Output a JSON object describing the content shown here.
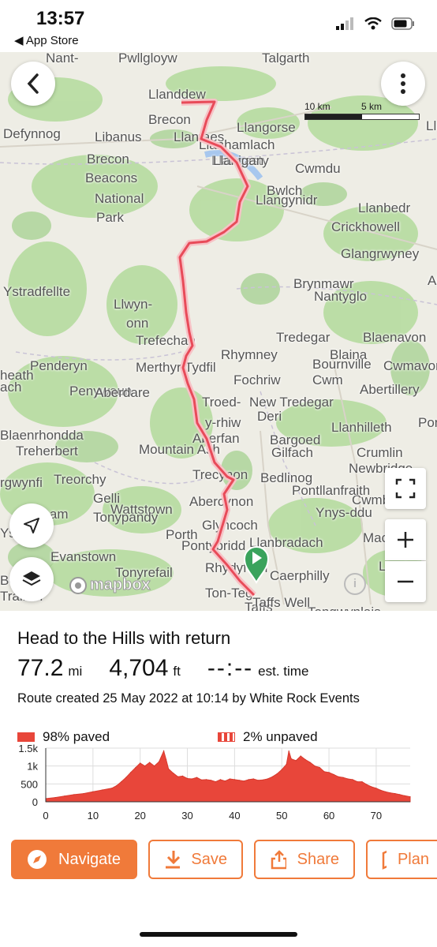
{
  "status": {
    "time": "13:57",
    "back_app": "App Store"
  },
  "map": {
    "scale": {
      "left": "10 km",
      "mid": "5 km"
    },
    "attribution": "mapbox",
    "places": [
      "Nant-",
      "Pwllgloyw",
      "Talgarth",
      "Llanddew",
      "Brecon",
      "Llangorse",
      "Defynnog",
      "Libanus",
      "Llanfaes",
      "Llanhamlach",
      "Llangasty",
      "Llanigan",
      "Brecon",
      "Beacons",
      "National",
      "Park",
      "Cwmdu",
      "Bwlch",
      "Llangynidr",
      "Llanbedr",
      "Crickhowell",
      "Glangrwyney",
      "Ystradfellte",
      "Llwyn-",
      "onn",
      "Brynmawr",
      "Nantyglo",
      "Trefechan",
      "Tredegar",
      "Blaina",
      "Blaenavon",
      "Penderyn",
      "Rhymney",
      "Bournville",
      "Cwmavon",
      "Merthyr Tydfil",
      "Cwm",
      "Abertillery",
      "Penywaun",
      "Fochriw",
      "Aberdare",
      "Troed-",
      "New Tredegar",
      "y-rhiw",
      "Deri",
      "Llanhilleth",
      "Blaenrhondda",
      "Aberfan",
      "Bargoed",
      "Treherbert",
      "Mountain Ash",
      "Gilfach",
      "Crumlin",
      "Treorchy",
      "Trecynon",
      "Newbridge",
      "Cwmbran",
      "Gelli",
      "Wattstown",
      "Abercynon",
      "Pontllanfraith",
      "Tonypandy",
      "Glyncoch",
      "Ynys-ddu",
      "Porth",
      "Llanbradach",
      "Evanstown",
      "Pontypridd",
      "Tonyrefail",
      "Rhydyfelin",
      "Caerphilly",
      "Ton-Teg",
      "Machen",
      "Tongwynlais",
      "Ystrad",
      "Llantwit",
      "Bedlinog",
      "heath",
      "ach",
      "Llan",
      "Ab",
      "Pont",
      "Taffs",
      "Taffs Well",
      "dham",
      "rgwynfi",
      "Bo",
      "Trallwn"
    ]
  },
  "route": {
    "title": "Head to the Hills with return",
    "distance": "77.2",
    "distance_unit": "mi",
    "elevation": "4,704",
    "elevation_unit": "ft",
    "time": "--:--",
    "time_unit": "est. time",
    "created": "Route created 25 May 2022 at 10:14 by White Rock Events"
  },
  "legend": {
    "paved": "98% paved",
    "unpaved": "2% unpaved"
  },
  "chart_data": {
    "type": "area",
    "xlabel": "",
    "ylabel": "",
    "x_ticks": [
      "0",
      "10",
      "20",
      "30",
      "40",
      "50",
      "60",
      "70"
    ],
    "y_ticks": [
      "0",
      "500",
      "1k",
      "1.5k"
    ],
    "xlim": [
      0,
      77.2
    ],
    "ylim": [
      0,
      1500
    ],
    "x": [
      0,
      2,
      4,
      6,
      8,
      10,
      12,
      14,
      15,
      16,
      17,
      18,
      19,
      20,
      21,
      22,
      23,
      24,
      25,
      25.5,
      26,
      27,
      28,
      29,
      30,
      31,
      32,
      33,
      34,
      35,
      36,
      37,
      38,
      39,
      40,
      41,
      42,
      43,
      44,
      45,
      46,
      47,
      48,
      49,
      50,
      51,
      51.5,
      52,
      53,
      54,
      55,
      56,
      57,
      58,
      59,
      60,
      61,
      62,
      63,
      64,
      65,
      66,
      67,
      68,
      69,
      70,
      71,
      72,
      73,
      74,
      75,
      76,
      77.2
    ],
    "y": [
      90,
      120,
      160,
      200,
      230,
      280,
      330,
      380,
      450,
      560,
      680,
      820,
      950,
      1080,
      1000,
      1100,
      1000,
      1120,
      1420,
      1180,
      920,
      800,
      700,
      720,
      650,
      640,
      680,
      610,
      620,
      600,
      560,
      620,
      580,
      640,
      620,
      600,
      580,
      620,
      640,
      600,
      610,
      640,
      700,
      780,
      900,
      1050,
      1420,
      1200,
      1150,
      1280,
      1180,
      1100,
      1000,
      960,
      840,
      820,
      760,
      700,
      680,
      640,
      620,
      560,
      560,
      480,
      420,
      380,
      320,
      280,
      250,
      230,
      200,
      170,
      140
    ]
  },
  "actions": {
    "navigate": "Navigate",
    "save": "Save",
    "share": "Share",
    "plan": "Plan"
  },
  "colors": {
    "accent": "#f07a3a",
    "route": "#e84b59",
    "elevation_fill": "#e8463a",
    "marker": "#3aa35c"
  }
}
